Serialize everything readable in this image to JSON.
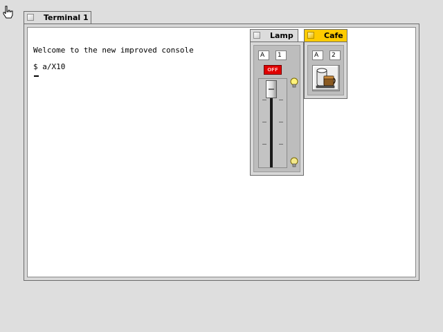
{
  "terminal": {
    "tab_title": "Terminal 1",
    "lines": [
      "Welcome to the new improved console",
      "$ a/X10"
    ]
  },
  "lamp": {
    "tab_title": "Lamp",
    "house_code": "A",
    "unit_code": "1",
    "off_label": "OFF",
    "brightness_level": 1.0
  },
  "cafe": {
    "tab_title": "Cafe",
    "house_code": "A",
    "unit_code": "2"
  },
  "icons": {
    "pointer": "hand-pointer-icon",
    "bulb": "light-bulb-icon",
    "coffee": "coffee-maker-icon"
  },
  "colors": {
    "active_tab": "#ffcb00",
    "off_button": "#e00000",
    "desktop": "#dedede"
  }
}
